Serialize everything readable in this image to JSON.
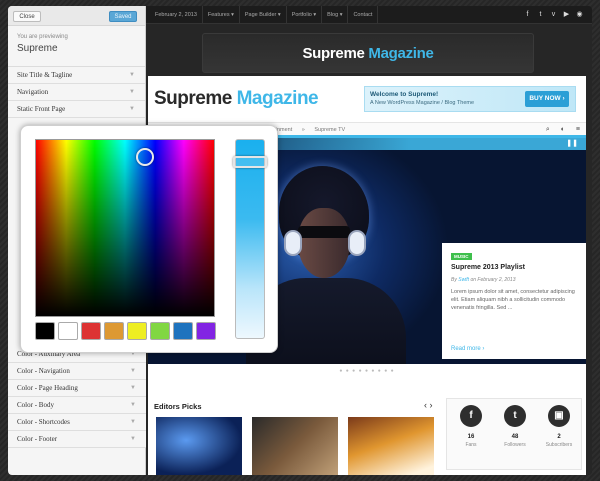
{
  "sidebar": {
    "close_label": "Close",
    "saved_label": "Saved",
    "preview_label": "You are previewing",
    "theme_name": "Supreme",
    "upper_items": [
      {
        "label": "Site Title & Tagline"
      },
      {
        "label": "Navigation"
      },
      {
        "label": "Static Front Page"
      }
    ],
    "lower_items": [
      {
        "label": "Color - Auxiliary Area"
      },
      {
        "label": "Color - Navigation"
      },
      {
        "label": "Color - Page Heading"
      },
      {
        "label": "Color - Body"
      },
      {
        "label": "Color - Shortcodes"
      },
      {
        "label": "Color - Footer"
      }
    ],
    "arrow_glyph": "▼"
  },
  "site": {
    "top_nav": [
      "February 2, 2013",
      "Features ▾",
      "Page Builder ▾",
      "Portfolio ▾",
      "Blog ▾",
      "Contact"
    ],
    "social_icons": [
      "f",
      "t",
      "v",
      "▶",
      "◉"
    ],
    "logo_main": "Supreme",
    "logo_accent": "Magazine",
    "banner": {
      "title": "Welcome to Supreme!",
      "subtitle": "A New WordPress Magazine / Blog Theme",
      "button": "BUY NOW ›"
    },
    "nav_items": [
      "Entertainment",
      "»",
      "Supreme TV"
    ],
    "nav_icons": [
      "⌕",
      "◐",
      "≡"
    ],
    "pause_glyph": "❚❚",
    "hero_card": {
      "tag": "MUSIC",
      "title": "Supreme 2013 Playlist",
      "meta_by": "By",
      "meta_author": "Swift",
      "meta_date": "on February 2, 2013",
      "text": "Lorem ipsum dolor sit amet, consectetur adipiscing elit. Etiam aliquam nibh a sollicitudin commodo venenatis fringilla. Sed ...",
      "read_more": "Read more ›"
    },
    "slider_dots": "● ● ● ● ● ● ● ● ●",
    "editors_picks": {
      "title": "Editors Picks",
      "arrows": "‹ ›"
    },
    "social_counts": [
      {
        "glyph": "f",
        "count": "16",
        "label": "Fans"
      },
      {
        "glyph": "t",
        "count": "48",
        "label": "Followers"
      },
      {
        "glyph": "▣",
        "count": "2",
        "label": "Subscribers"
      }
    ]
  },
  "color_picker": {
    "swatches": [
      "#000000",
      "#ffffff",
      "#dd3333",
      "#dd9933",
      "#eeee22",
      "#81d742",
      "#1e73be",
      "#8224e3"
    ],
    "selected_color": "#1ab0ee"
  }
}
